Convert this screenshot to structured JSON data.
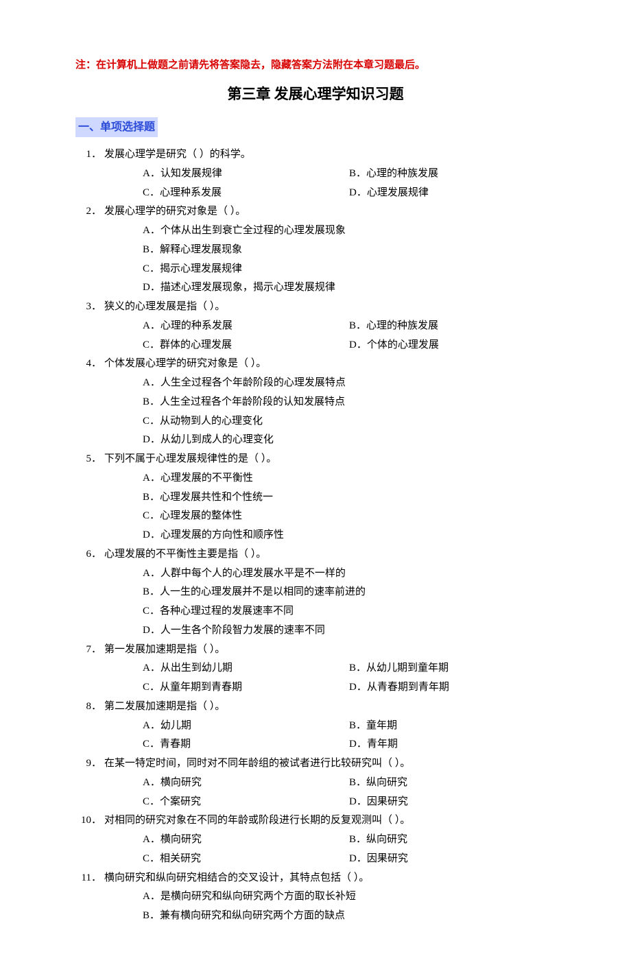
{
  "note": "注：在计算机上做题之前请先将答案隐去，隐藏答案方法附在本章习题最后。",
  "chapter_title": "第三章  发展心理学知识习题",
  "section_heading": "一、单项选择题",
  "questions": [
    {
      "num": "1．",
      "text": "发展心理学是研究（    ）的科学。",
      "layout": "two-col",
      "opts": [
        {
          "k": "A．",
          "v": "认知发展规律"
        },
        {
          "k": "B．",
          "v": "心理的种族发展"
        },
        {
          "k": "C．",
          "v": "心理种系发展"
        },
        {
          "k": "D．",
          "v": "心理发展规律"
        }
      ]
    },
    {
      "num": "2．",
      "text": "发展心理学的研究对象是（   ）。",
      "layout": "one-col",
      "opts": [
        {
          "k": "A．",
          "v": "个体从出生到衰亡全过程的心理发展现象"
        },
        {
          "k": "B．",
          "v": "解释心理发展现象"
        },
        {
          "k": "C．",
          "v": "揭示心理发展规律"
        },
        {
          "k": "D．",
          "v": "描述心理发展现象，揭示心理发展规律"
        }
      ]
    },
    {
      "num": "3．",
      "text": "狭义的心理发展是指（  ）。",
      "layout": "two-col-wide",
      "opts": [
        {
          "k": "A．",
          "v": "心理的种系发展"
        },
        {
          "k": "B．",
          "v": "心理的种族发展"
        },
        {
          "k": "C．",
          "v": "群体的心理发展"
        },
        {
          "k": "D．",
          "v": "个体的心理发展"
        }
      ]
    },
    {
      "num": "4．",
      "text": "个体发展心理学的研究对象是（   ）。",
      "layout": "one-col",
      "opts": [
        {
          "k": "A．",
          "v": "人生全过程各个年龄阶段的心理发展特点"
        },
        {
          "k": "B．",
          "v": "人生全过程各个年龄阶段的认知发展特点"
        },
        {
          "k": "C．",
          "v": "从动物到人的心理变化"
        },
        {
          "k": "D．",
          "v": "从幼儿到成人的心理变化"
        }
      ]
    },
    {
      "num": "5．",
      "text": "下列不属于心理发展规律性的是（   ）。",
      "layout": "one-col",
      "opts": [
        {
          "k": "A．",
          "v": "心理发展的不平衡性"
        },
        {
          "k": "B．",
          "v": "心理发展共性和个性统一"
        },
        {
          "k": "C．",
          "v": "心理发展的整体性"
        },
        {
          "k": "D．",
          "v": "心理发展的方向性和顺序性"
        }
      ]
    },
    {
      "num": "6．",
      "text": "心理发展的不平衡性主要是指（  ）。",
      "layout": "one-col",
      "opts": [
        {
          "k": "A．",
          "v": "人群中每个人的心理发展水平是不一样的"
        },
        {
          "k": "B．",
          "v": "人一生的心理发展并不是以相同的速率前进的"
        },
        {
          "k": "C．",
          "v": "各种心理过程的发展速率不同"
        },
        {
          "k": "D．",
          "v": "人一生各个阶段智力发展的速率不同"
        }
      ]
    },
    {
      "num": "7．",
      "text": "第一发展加速期是指（  ）。",
      "layout": "two-col",
      "opts": [
        {
          "k": "A．",
          "v": "从出生到幼儿期"
        },
        {
          "k": "B．",
          "v": "从幼儿期到童年期"
        },
        {
          "k": "C．",
          "v": "从童年期到青春期"
        },
        {
          "k": "D．",
          "v": "从青春期到青年期"
        }
      ]
    },
    {
      "num": "8．",
      "text": "第二发展加速期是指（  ）。",
      "layout": "two-col",
      "opts": [
        {
          "k": "A．",
          "v": "幼儿期"
        },
        {
          "k": "B．",
          "v": "童年期"
        },
        {
          "k": "C．",
          "v": "青春期"
        },
        {
          "k": "D．",
          "v": "青年期"
        }
      ]
    },
    {
      "num": "9．",
      "text": "在某一特定时间，同时对不同年龄组的被试者进行比较研究叫（    ）。",
      "layout": "two-col",
      "opts": [
        {
          "k": "A．",
          "v": "横向研究"
        },
        {
          "k": "B．",
          "v": "纵向研究"
        },
        {
          "k": "C．",
          "v": "个案研究"
        },
        {
          "k": "D．",
          "v": "因果研究"
        }
      ]
    },
    {
      "num": "10．",
      "text": "对相同的研究对象在不同的年龄或阶段进行长期的反复观测叫（    ）。",
      "layout": "two-col",
      "opts": [
        {
          "k": "A．",
          "v": "横向研究"
        },
        {
          "k": "B．",
          "v": "纵向研究"
        },
        {
          "k": "C．",
          "v": "相关研究"
        },
        {
          "k": "D．",
          "v": "因果研究"
        }
      ]
    },
    {
      "num": "11．",
      "text": "横向研究和纵向研究相结合的交叉设计，其特点包括（    ）。",
      "layout": "one-col",
      "opts": [
        {
          "k": "A．",
          "v": "是横向研究和纵向研究两个方面的取长补短"
        },
        {
          "k": "B．",
          "v": "兼有横向研究和纵向研究两个方面的缺点"
        }
      ]
    }
  ]
}
